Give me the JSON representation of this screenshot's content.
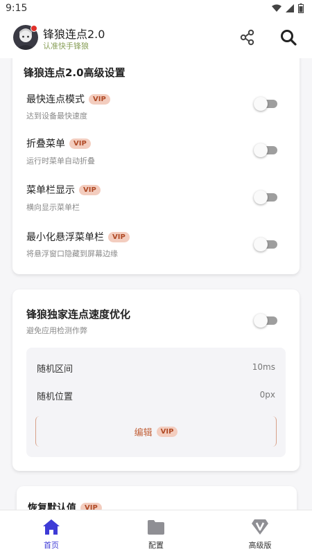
{
  "status_bar": {
    "time": "9:15"
  },
  "header": {
    "title": "锋狼连点2.0",
    "subtitle": "认准快手锋狼"
  },
  "settings_card": {
    "title": "锋狼连点2.0高级设置",
    "items": [
      {
        "title": "最快连点模式",
        "badge": "VIP",
        "desc": "达到设备最快速度",
        "enabled": false
      },
      {
        "title": "折叠菜单",
        "badge": "VIP",
        "desc": "运行时菜单自动折叠",
        "enabled": false
      },
      {
        "title": "菜单栏显示",
        "badge": "VIP",
        "desc": "横向显示菜单栏",
        "enabled": false
      },
      {
        "title": "最小化悬浮菜单栏",
        "badge": "VIP",
        "desc": "将悬浮窗口隐藏到屏幕边缘",
        "enabled": false
      }
    ]
  },
  "speed_card": {
    "title": "锋狼独家连点速度优化",
    "desc": "避免应用检测作弊",
    "enabled": false,
    "random_interval_label": "随机区间",
    "random_interval_value": "10ms",
    "random_position_label": "随机位置",
    "random_position_value": "0px",
    "edit_label": "编辑",
    "edit_badge": "VIP"
  },
  "reset_card": {
    "title": "恢复默认值",
    "badge": "VIP"
  },
  "bottom_nav": [
    {
      "label": "首页",
      "icon": "home-icon",
      "active": true
    },
    {
      "label": "配置",
      "icon": "folder-icon",
      "active": false
    },
    {
      "label": "高级版",
      "icon": "vip-badge-icon",
      "active": false
    }
  ],
  "colors": {
    "accent": "#3e3bd6",
    "vip_bg": "#f3cdbf",
    "vip_text": "#b04a26"
  }
}
